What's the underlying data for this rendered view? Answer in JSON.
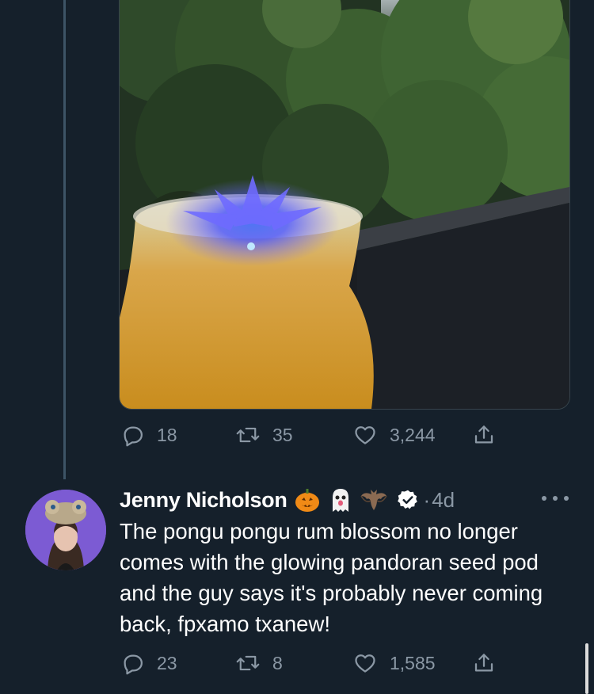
{
  "first_tweet": {
    "media_alt": "Glowing cocktail photo",
    "replies": "18",
    "retweets": "35",
    "likes": "3,244"
  },
  "reply_tweet": {
    "author_name": "Jenny Nicholson",
    "name_emojis": [
      "pumpkin-emoji",
      "ghost-emoji",
      "bat-emoji"
    ],
    "separator": "·",
    "time": "4d",
    "text": "The pongu pongu rum blossom no longer comes with the glowing pandoran seed pod and the guy says it's probably never coming back, fpxamo txanew!",
    "replies": "23",
    "retweets": "8",
    "likes": "1,585"
  },
  "colors": {
    "background": "#15202b",
    "secondary_text": "#8b98a5",
    "thread_line": "#3d5466"
  }
}
